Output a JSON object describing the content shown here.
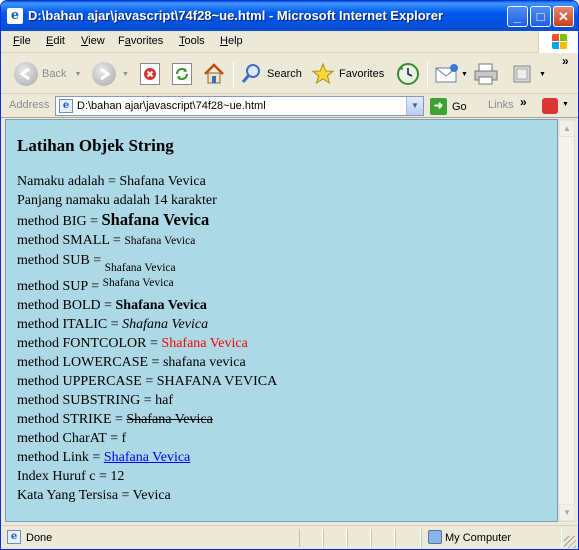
{
  "window": {
    "title": "D:\\bahan ajar\\javascript\\74f28~ue.html - Microsoft Internet Explorer",
    "title_icon": "ie-e-icon",
    "controls": {
      "minimize": "_",
      "maximize": "□",
      "close": "✕"
    }
  },
  "menubar": {
    "items": [
      {
        "accel": "F",
        "rest": "ile"
      },
      {
        "accel": "E",
        "rest": "dit"
      },
      {
        "accel": "V",
        "rest": "iew"
      },
      {
        "pre": "F",
        "accel": "a",
        "rest": "vorites"
      },
      {
        "accel": "T",
        "rest": "ools"
      },
      {
        "accel": "H",
        "rest": "elp"
      }
    ]
  },
  "toolbar": {
    "back_label": "Back",
    "search_label": "Search",
    "favorites_label": "Favorites",
    "overflow": "»"
  },
  "addressbar": {
    "label": "Address",
    "url": "D:\\bahan ajar\\javascript\\74f28~ue.html",
    "go_label": "Go",
    "links_label": "Links",
    "links_chevron": "»"
  },
  "page": {
    "heading": "Latihan Objek String",
    "lines": {
      "name_prefix": "Namaku adalah = ",
      "name_value": "Shafana Vevica",
      "length": "Panjang namaku adalah 14 karakter",
      "big_prefix": "method BIG = ",
      "big_value": "Shafana Vevica",
      "small_prefix": "method SMALL = ",
      "small_value": "Shafana Vevica",
      "sub_prefix": "method SUB = ",
      "sub_value": "Shafana Vevica",
      "sup_prefix": "method SUP = ",
      "sup_value": "Shafana Vevica",
      "bold_prefix": "method BOLD = ",
      "bold_value": "Shafana Vevica",
      "italic_prefix": "method ITALIC = ",
      "italic_value": "Shafana Vevica",
      "fontcolor_prefix": "method FONTCOLOR = ",
      "fontcolor_value": "Shafana Vevica",
      "fontcolor_color": "#ff0000",
      "lower": "method LOWERCASE = shafana vevica",
      "upper": "method UPPERCASE = SHAFANA VEVICA",
      "substring": "method SUBSTRING = haf",
      "strike_prefix": "method STRIKE = ",
      "strike_value": "Shafana Vevica",
      "charat": "method CharAT = f",
      "link_prefix": "method Link = ",
      "link_value": "Shafana Vevica",
      "index": "Index Huruf c = 12",
      "rest": "Kata Yang Tersisa = Vevica"
    },
    "background": "#add8e6"
  },
  "statusbar": {
    "status": "Done",
    "zone": "My Computer"
  }
}
